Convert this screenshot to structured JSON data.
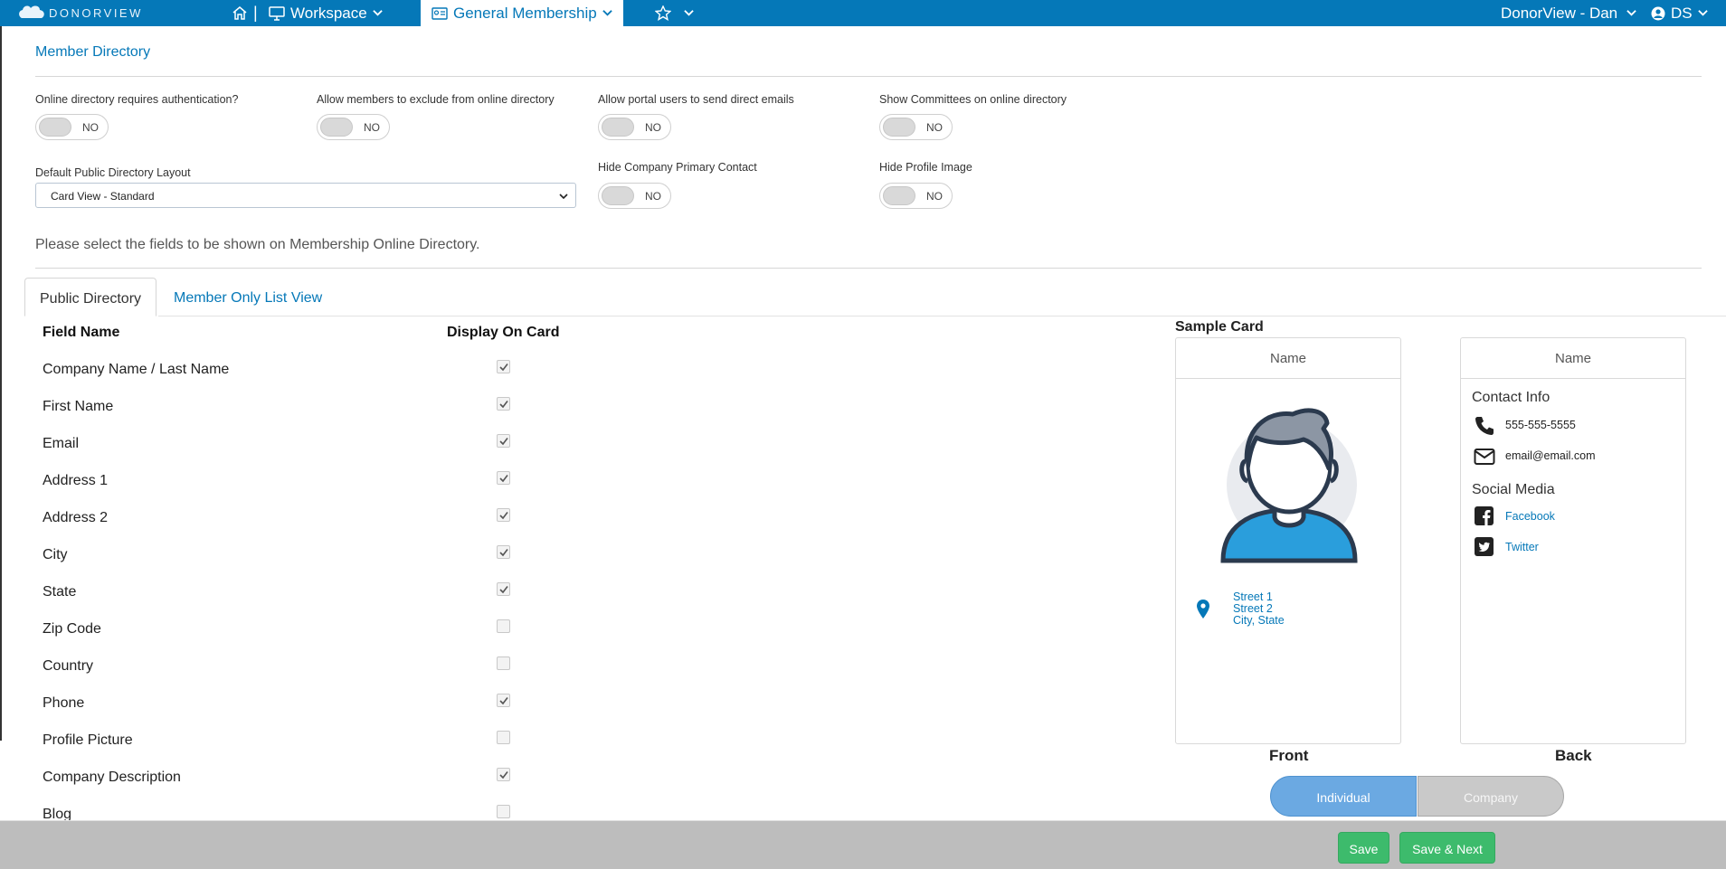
{
  "topbar": {
    "logo_text": "DONORVIEW",
    "workspace_label": "Workspace",
    "module_label": "General Membership",
    "org_label": "DonorView - Dan",
    "user_initials": "DS",
    "separator": "|"
  },
  "page": {
    "section_title": "Member Directory",
    "options": [
      {
        "label": "Online directory requires authentication?",
        "value": "NO"
      },
      {
        "label": "Allow members to exclude from online directory",
        "value": "NO"
      },
      {
        "label": "Allow portal users to send direct emails",
        "value": "NO"
      },
      {
        "label": "Show Committees on online directory",
        "value": "NO"
      },
      {
        "label": "Hide Company Primary Contact",
        "value": "NO"
      },
      {
        "label": "Hide Profile Image",
        "value": "NO"
      }
    ],
    "layout_label": "Default Public Directory Layout",
    "layout_value": "Card View - Standard",
    "instructions": "Please select the fields to be shown on Membership Online Directory."
  },
  "tabs": [
    {
      "label": "Public Directory",
      "active": true
    },
    {
      "label": "Member Only List View",
      "active": false
    }
  ],
  "table": {
    "col_field": "Field Name",
    "col_display": "Display On Card",
    "rows": [
      {
        "name": "Company Name / Last Name",
        "checked": true
      },
      {
        "name": "First Name",
        "checked": true
      },
      {
        "name": "Email",
        "checked": true
      },
      {
        "name": "Address 1",
        "checked": true
      },
      {
        "name": "Address 2",
        "checked": true
      },
      {
        "name": "City",
        "checked": true
      },
      {
        "name": "State",
        "checked": true
      },
      {
        "name": "Zip Code",
        "checked": false
      },
      {
        "name": "Country",
        "checked": false
      },
      {
        "name": "Phone",
        "checked": true
      },
      {
        "name": "Profile Picture",
        "checked": false
      },
      {
        "name": "Company Description",
        "checked": true
      },
      {
        "name": "Blog",
        "checked": false
      }
    ]
  },
  "sample": {
    "title": "Sample Card",
    "front_head": "Name",
    "back_head": "Name",
    "address_lines": [
      "Street 1",
      "Street 2",
      "City, State"
    ],
    "contact_title": "Contact Info",
    "phone": "555-555-5555",
    "email": "email@email.com",
    "social_title": "Social Media",
    "facebook": "Facebook",
    "twitter": "Twitter",
    "front_caption": "Front",
    "back_caption": "Back",
    "seg_individual": "Individual",
    "seg_company": "Company"
  },
  "footer": {
    "save": "Save",
    "save_next": "Save & Next"
  },
  "colors": {
    "brand_blue": "#0578b8",
    "save_green": "#3dbb6c"
  }
}
